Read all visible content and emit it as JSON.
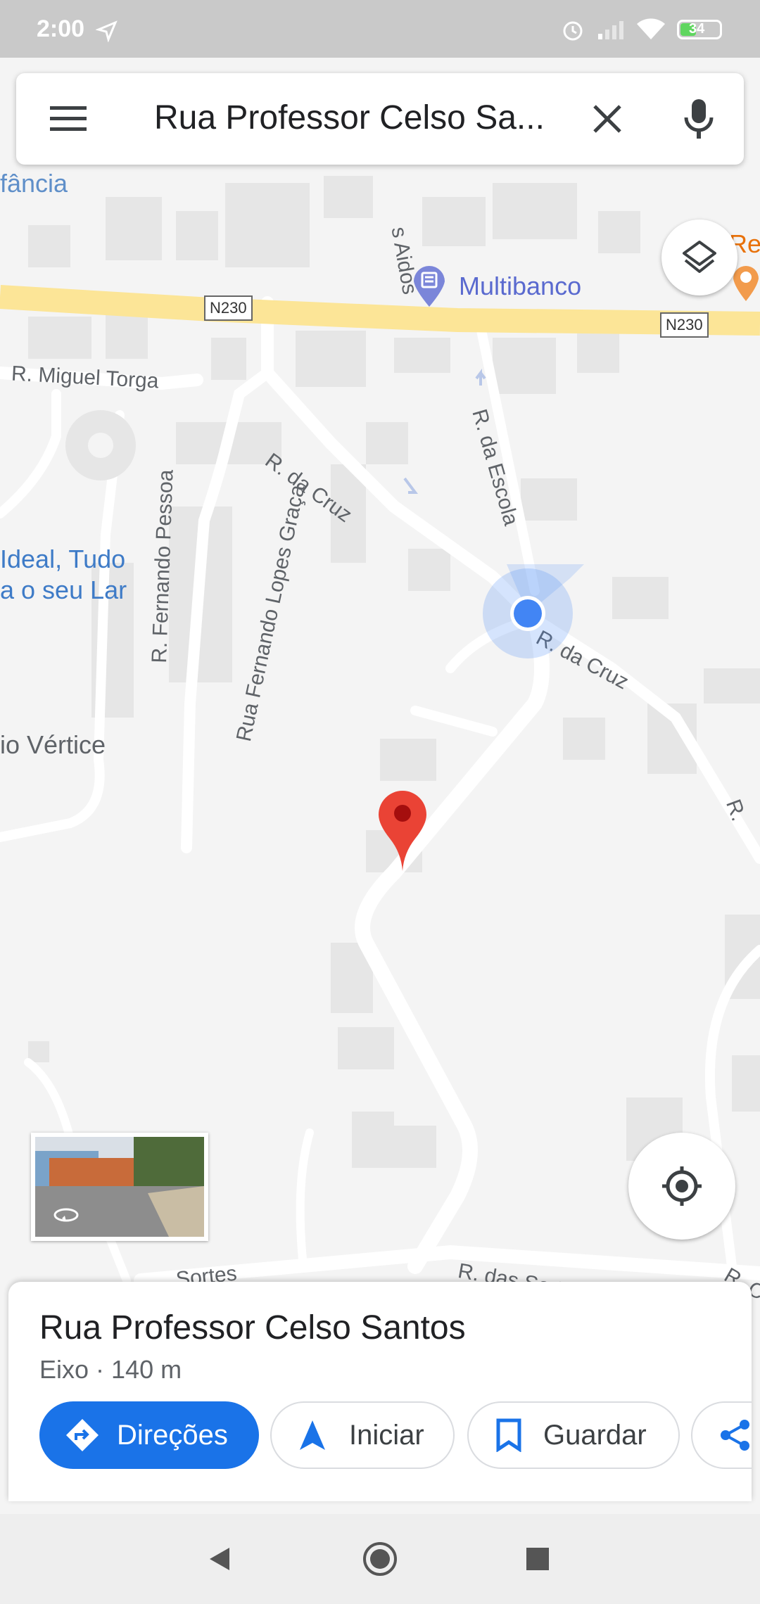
{
  "status_bar": {
    "time": "2:00",
    "battery": "34"
  },
  "search": {
    "query": "Rua Professor Celso Sa..."
  },
  "map": {
    "roads": {
      "n230_left": "N230",
      "n230_right": "N230",
      "miguel_torga": "R. Miguel Torga",
      "da_cruz_upper": "R. da Cruz",
      "da_cruz_lower": "R. da Cruz",
      "da_escola": "R. da Escola",
      "fernando_pessoa": "R. Fernando Pessoa",
      "fernando_lopes_graca": "Rua Fernando Lopes Graça",
      "das_sortes": "R. das Sortes",
      "dos_aidos": "s Aidos",
      "sortes_left": "Sortes",
      "r_right": "R.",
      "r_bottom_right": "R. C"
    },
    "places": {
      "infancia": "fância",
      "multibanco": "Multibanco",
      "ideal_line1": "Ideal, Tudo",
      "ideal_line2": "a o seu Lar",
      "vertice": "io Vértice",
      "res": "Res"
    },
    "colors": {
      "highway": "#fce597",
      "road": "#ffffff",
      "building": "#e8e8e8",
      "poi_text": "#1a73e8",
      "pin": "#ea4335",
      "location_dot": "#4285f4"
    }
  },
  "place_sheet": {
    "title": "Rua Professor Celso Santos",
    "subtitle": "Eixo · 140 m",
    "actions": {
      "directions": "Direções",
      "start": "Iniciar",
      "save": "Guardar"
    }
  },
  "icons": {
    "menu": "menu-icon",
    "clear": "close-icon",
    "mic": "microphone-icon",
    "layers": "layers-icon",
    "my_location": "my-location-icon",
    "street_view": "street-view-icon",
    "directions": "directions-icon",
    "navigation": "navigation-arrow-icon",
    "bookmark": "bookmark-icon",
    "share": "share-icon"
  }
}
